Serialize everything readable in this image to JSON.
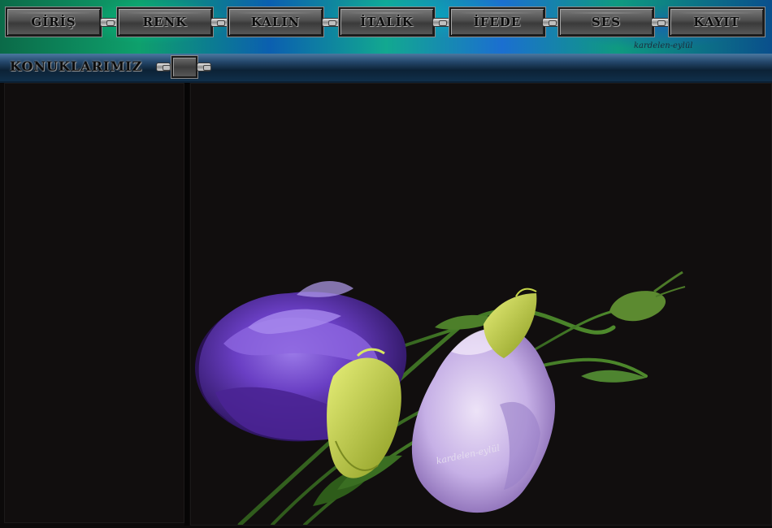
{
  "nav": {
    "items": [
      {
        "label": "GİRİŞ"
      },
      {
        "label": "RENK"
      },
      {
        "label": "KALIN"
      },
      {
        "label": "İTALİK"
      },
      {
        "label": "İFEDE"
      },
      {
        "label": "SES"
      },
      {
        "label": "KAYIT"
      }
    ],
    "watermark": "kardelen-eylül"
  },
  "guests": {
    "title": "KONUKLARIMIZ"
  },
  "image": {
    "watermark": "kardelen-eylül"
  },
  "colors": {
    "nav_band_green": "#0ea06c",
    "nav_band_blue": "#0b5fb0",
    "button_metal": "#5a5a5a",
    "panel_bg": "#110e0e",
    "flower_purple": "#6a3fc4",
    "flower_lavender": "#c6b0e6",
    "bud_green": "#c8d84a"
  }
}
